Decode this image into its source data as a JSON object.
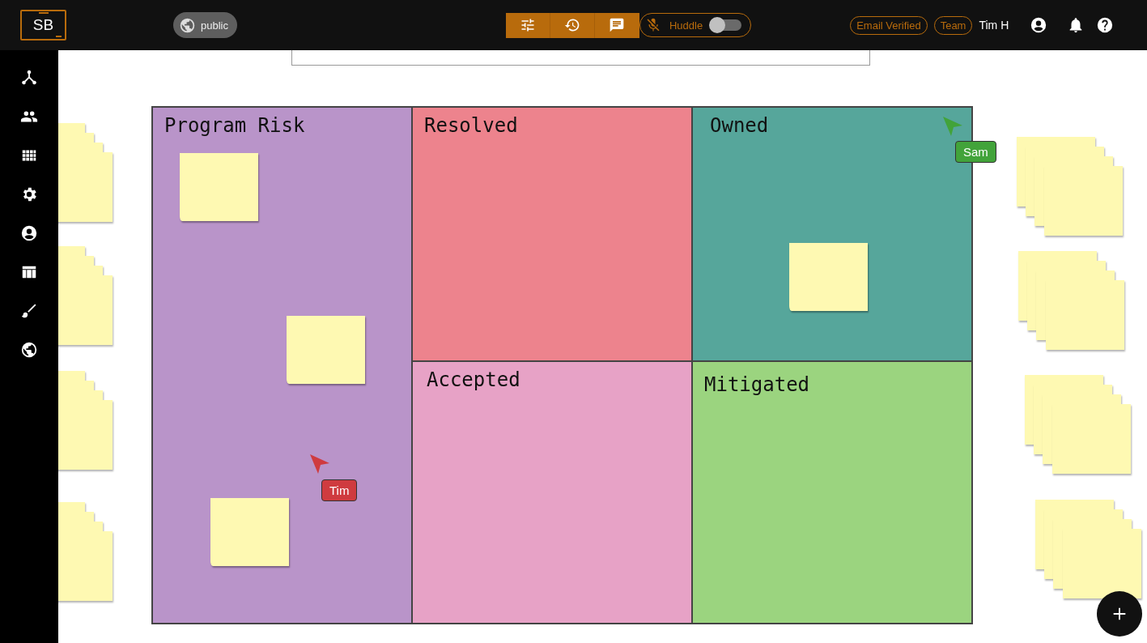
{
  "header": {
    "logo": "SB",
    "visibility": {
      "label": "public"
    },
    "huddle": {
      "label": "Huddle",
      "on": false,
      "muted": true
    },
    "badges": [
      "Email Verified",
      "Team"
    ],
    "user": "Tim H"
  },
  "board": {
    "quadrants": [
      {
        "title": "Program Risk",
        "color": "#b994c9"
      },
      {
        "title": "Resolved",
        "color": "#ed838d"
      },
      {
        "title": "Owned",
        "color": "#56a69b"
      },
      {
        "title": "Accepted",
        "color": "#e7a2c6"
      },
      {
        "title": "Mitigated",
        "color": "#9bd47f"
      }
    ]
  },
  "cursors": [
    {
      "name": "Tim",
      "color": "#cf3b3f"
    },
    {
      "name": "Sam",
      "color": "#42a33a"
    }
  ]
}
